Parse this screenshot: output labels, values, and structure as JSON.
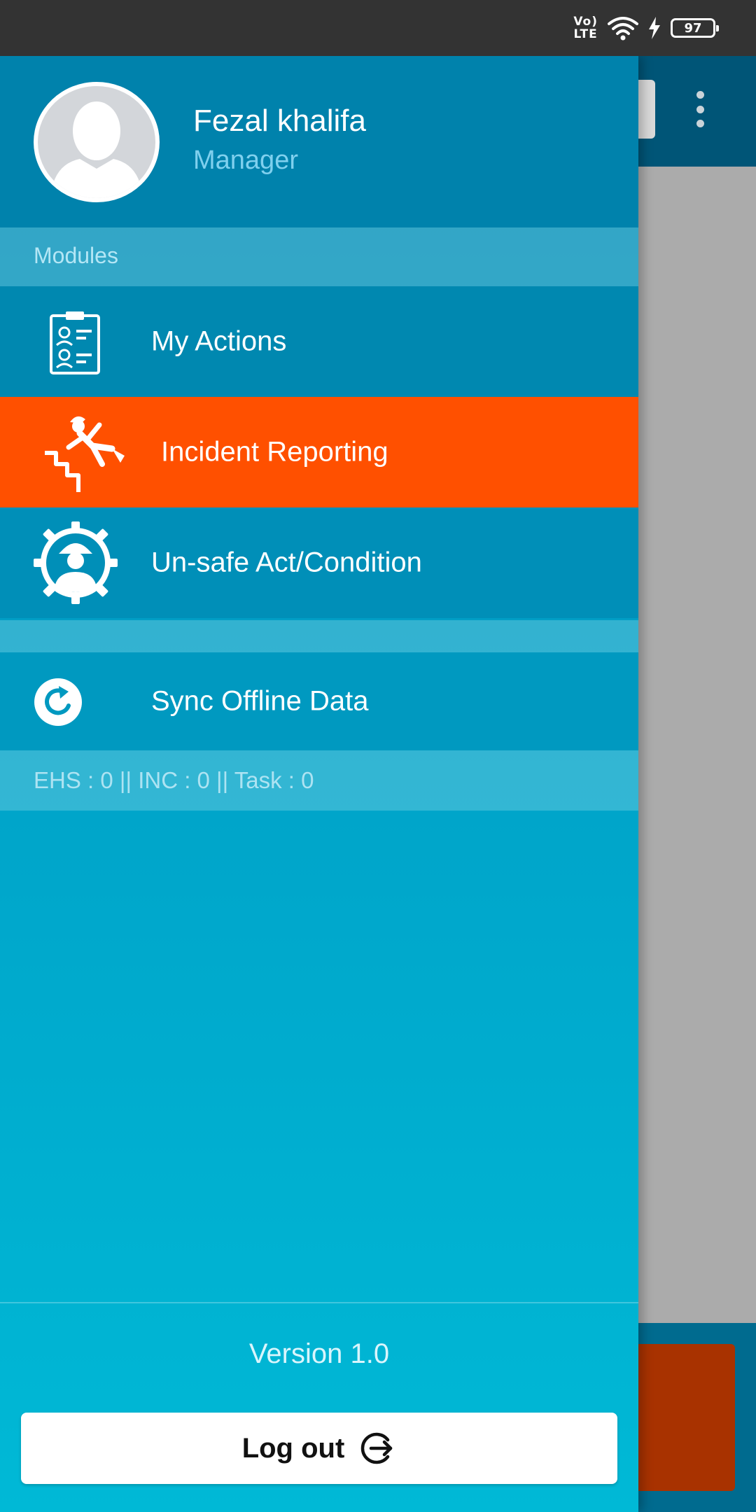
{
  "status_bar": {
    "network_label": "Vo\nLTE",
    "battery_level": "97"
  },
  "profile": {
    "name": "Fezal khalifa",
    "role": "Manager"
  },
  "modules_header": "Modules",
  "menu": {
    "items": [
      {
        "label": "My Actions",
        "icon": "clipboard-workers-icon",
        "active": false
      },
      {
        "label": "Incident Reporting",
        "icon": "falling-person-stairs-icon",
        "active": true
      },
      {
        "label": "Un-safe Act/Condition",
        "icon": "worker-gear-icon",
        "active": false
      }
    ]
  },
  "sync": {
    "label": "Sync Offline Data",
    "icon": "sync-icon"
  },
  "counts": "EHS : 0 || INC : 0 || Task : 0",
  "footer": {
    "version": "Version 1.0",
    "logout_label": "Log out"
  },
  "colors": {
    "drawer_top": "#0089b3",
    "drawer_bottom": "#00b9d6",
    "active_item": "#ff5000",
    "status_bar": "#333333"
  }
}
